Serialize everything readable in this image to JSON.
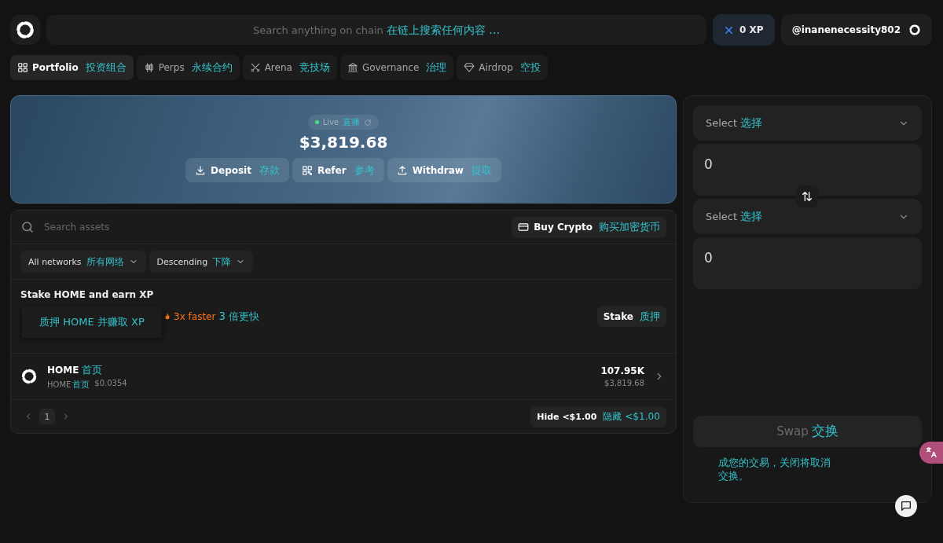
{
  "search": {
    "placeholder": "Search anything on chain",
    "placeholder_translation": "在链上搜索任何内容 ..."
  },
  "xp_button": {
    "label": "0 XP"
  },
  "user_button": {
    "label": "@inanenecessity802"
  },
  "tabs": [
    {
      "label": "Portfolio",
      "translation": "投资组合",
      "selected": true
    },
    {
      "label": "Perps",
      "translation": "永续合约",
      "selected": false
    },
    {
      "label": "Arena",
      "translation": "竞技场",
      "selected": false
    },
    {
      "label": "Governance",
      "translation": "治理",
      "selected": false
    },
    {
      "label": "Airdrop",
      "translation": "空投",
      "selected": false
    }
  ],
  "hero": {
    "live": {
      "label": "Live",
      "translation": "直播"
    },
    "balance": "$3,819.68",
    "actions": [
      {
        "label": "Deposit",
        "translation": "存款"
      },
      {
        "label": "Refer",
        "translation": "参考"
      },
      {
        "label": "Withdraw",
        "translation": "提取"
      }
    ]
  },
  "assets": {
    "search": {
      "placeholder": "Search assets"
    },
    "buy_button": {
      "label": "Buy Crypto",
      "translation": "购买加密货币"
    },
    "filters": [
      {
        "label": "All networks",
        "translation": "所有网络"
      },
      {
        "label": "Descending",
        "translation": "下降"
      }
    ],
    "promo": {
      "title": "Stake HOME and earn XP",
      "tooltip": "质押 HOME 并赚取 XP",
      "boost": "3x faster",
      "boost_translation": "3 倍更快",
      "button": {
        "label": "Stake",
        "translation": "质押"
      }
    },
    "rows": [
      {
        "symbol": "HOME",
        "symbol_translation": "首页",
        "sub": "HOME",
        "sub_translation": "首页",
        "price": "$0.0354",
        "amount": "107.95K",
        "value": "$3,819.68"
      }
    ],
    "pagination": {
      "page": "1"
    },
    "hide_button": {
      "label": "Hide <$1.00",
      "translation": "隐藏 <$1.00"
    }
  },
  "swap": {
    "legs": [
      {
        "label": "Select",
        "translation": "选择",
        "amount": "0"
      },
      {
        "label": "Select",
        "translation": "选择",
        "amount": "0"
      }
    ],
    "button": {
      "label": "Swap",
      "translation": "交换",
      "disabled": true
    },
    "notice": "成您的交易，关闭将取消交换。"
  }
}
